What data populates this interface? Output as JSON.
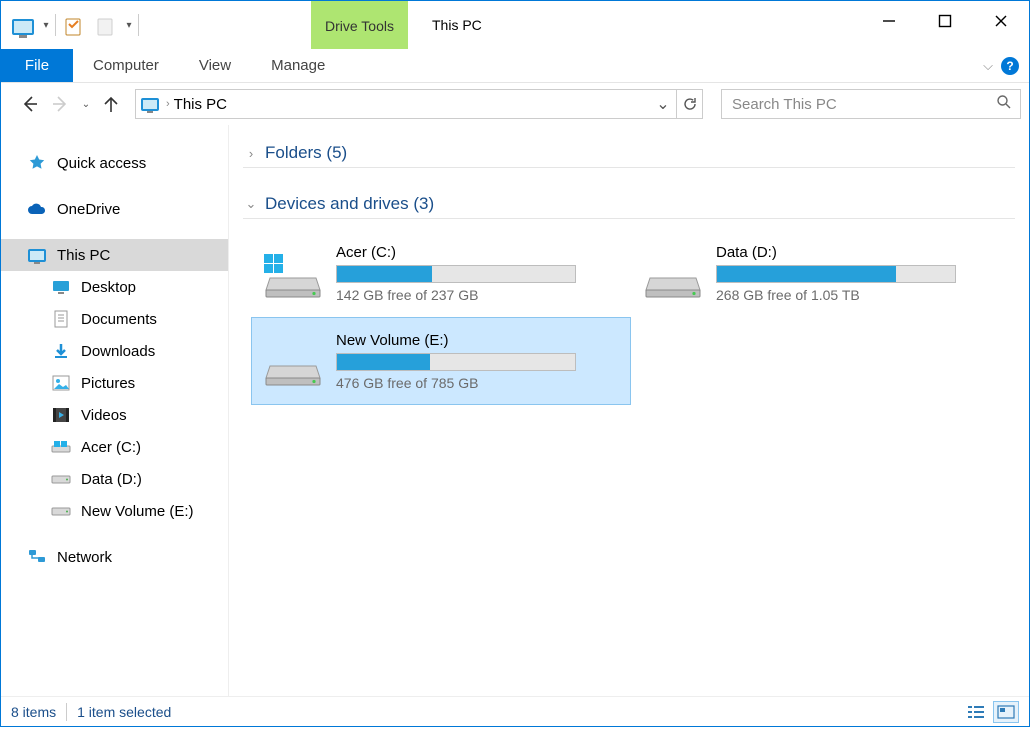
{
  "window": {
    "title": "This PC",
    "context_tab": "Drive Tools"
  },
  "ribbon": {
    "file": "File",
    "tabs": [
      "Computer",
      "View",
      "Manage"
    ]
  },
  "addressbar": {
    "location": "This PC"
  },
  "search": {
    "placeholder": "Search This PC"
  },
  "sidebar": {
    "quick_access": "Quick access",
    "onedrive": "OneDrive",
    "this_pc": "This PC",
    "children": [
      "Desktop",
      "Documents",
      "Downloads",
      "Pictures",
      "Videos",
      "Acer (C:)",
      "Data (D:)",
      "New Volume (E:)"
    ],
    "network": "Network"
  },
  "sections": {
    "folders": {
      "label": "Folders",
      "count": 5
    },
    "drives": {
      "label": "Devices and drives",
      "count": 3
    }
  },
  "drives": [
    {
      "name": "Acer (C:)",
      "free": "142 GB free of 237 GB",
      "fill_pct": 40,
      "os_badge": true,
      "selected": false
    },
    {
      "name": "Data (D:)",
      "free": "268 GB free of 1.05 TB",
      "fill_pct": 75,
      "os_badge": false,
      "selected": false
    },
    {
      "name": "New Volume (E:)",
      "free": "476 GB free of 785 GB",
      "fill_pct": 39,
      "os_badge": false,
      "selected": true
    }
  ],
  "statusbar": {
    "items": "8 items",
    "selected": "1 item selected"
  }
}
